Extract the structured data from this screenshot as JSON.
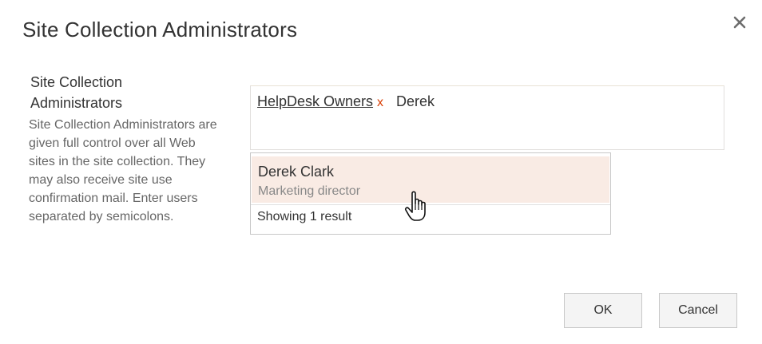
{
  "dialog": {
    "title": "Site Collection Administrators",
    "close_icon": "close-icon"
  },
  "section": {
    "heading": "Site Collection Administrators",
    "description": "Site Collection Administrators are given full control over all Web sites in the site collection. They may also receive site use confirmation mail. Enter users separated by semicolons."
  },
  "people_picker": {
    "resolved_users": [
      {
        "name": "HelpDesk Owners",
        "remove_label": "x"
      }
    ],
    "input_value": "Derek"
  },
  "suggestions": {
    "items": [
      {
        "name": "Derek Clark",
        "title": "Marketing director"
      }
    ],
    "count_text": "Showing 1 result",
    "highlight_color": "#f9ebe4"
  },
  "buttons": {
    "ok_label": "OK",
    "cancel_label": "Cancel"
  },
  "colors": {
    "remove_accent": "#d83b01"
  }
}
